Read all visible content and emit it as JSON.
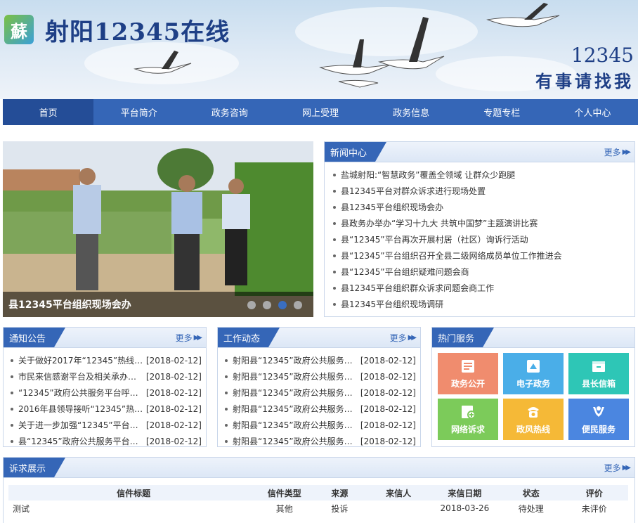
{
  "header": {
    "logo_char": "蘇",
    "title": "射阳12345在线",
    "slogan_number": "12345",
    "slogan_text": "有事请找我"
  },
  "nav": {
    "items": [
      "首页",
      "平台简介",
      "政务咨询",
      "网上受理",
      "政务信息",
      "专题专栏",
      "个人中心"
    ],
    "active_index": 0
  },
  "slideshow": {
    "caption": "县12345平台组织现场会办",
    "dots": 4,
    "active_dot": 2
  },
  "news": {
    "title": "新闻中心",
    "more": "更多",
    "items": [
      "盐城射阳:“智慧政务”覆盖全领域 让群众少跑腿",
      "县12345平台对群众诉求进行现场处置",
      "县12345平台组织现场会办",
      "县政务办举办“学习十九大 共筑中国梦”主题演讲比赛",
      "县“12345”平台再次开展村居（社区）询诉行活动",
      "县“12345”平台组织召开全县二级网络成员单位工作推进会",
      "县“12345”平台组织疑难问题会商",
      "县12345平台组织群众诉求问题会商工作",
      "县12345平台组织现场调研"
    ]
  },
  "notices": {
    "title": "通知公告",
    "more": "更多",
    "items": [
      {
        "title": "关于做好2017年“12345”热线春...",
        "date": "[2018-02-12]"
      },
      {
        "title": "市民来信感谢平台及相关承办单...",
        "date": "[2018-02-12]"
      },
      {
        "title": "“12345”政府公共服务平台呼叫中...",
        "date": "[2018-02-12]"
      },
      {
        "title": "2016年县领导接听“12345”热线...",
        "date": "[2018-02-12]"
      },
      {
        "title": "关于进一步加强“12345”平台工单...",
        "date": "[2018-02-12]"
      },
      {
        "title": "县“12345”政府公共服务平台201...",
        "date": "[2018-02-12]"
      }
    ]
  },
  "work": {
    "title": "工作动态",
    "more": "更多",
    "items": [
      {
        "title": "射阳县“12345”政府公共服务平台...",
        "date": "[2018-02-12]"
      },
      {
        "title": "射阳县“12345”政府公共服务平台...",
        "date": "[2018-02-12]"
      },
      {
        "title": "射阳县“12345”政府公共服务平台...",
        "date": "[2018-02-12]"
      },
      {
        "title": "射阳县“12345”政府公共服务平台...",
        "date": "[2018-02-12]"
      },
      {
        "title": "射阳县“12345”政府公共服务平台...",
        "date": "[2018-02-12]"
      },
      {
        "title": "射阳县“12345”政府公共服务平台...",
        "date": "[2018-02-12]"
      }
    ]
  },
  "services": {
    "title": "热门服务",
    "items": [
      {
        "label": "政务公开",
        "color": "#f08c6e",
        "icon": "document-icon"
      },
      {
        "label": "电子政务",
        "color": "#4aaee8",
        "icon": "e-government-icon"
      },
      {
        "label": "县长信箱",
        "color": "#2ec6b6",
        "icon": "mailbox-icon"
      },
      {
        "label": "网络诉求",
        "color": "#7ccb5a",
        "icon": "online-appeal-icon"
      },
      {
        "label": "政风热线",
        "color": "#f5b937",
        "icon": "phone-icon"
      },
      {
        "label": "便民服务",
        "color": "#4b86e0",
        "icon": "helping-hands-icon"
      }
    ]
  },
  "appeals": {
    "title": "诉求展示",
    "more": "更多",
    "columns": [
      "信件标题",
      "信件类型",
      "来源",
      "来信人",
      "来信日期",
      "状态",
      "评价"
    ],
    "rows": [
      [
        "测试",
        "其他",
        "投诉",
        "",
        "2018-03-26",
        "待处理",
        "未评价"
      ]
    ]
  }
}
